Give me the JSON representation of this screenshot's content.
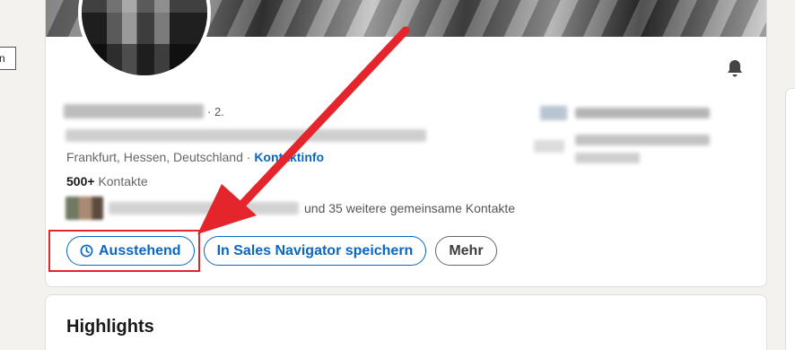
{
  "tooltip": {
    "text": "n"
  },
  "profile": {
    "degree": "· 2.",
    "location": "Frankfurt, Hessen, Deutschland ·",
    "contact_info": "Kontaktinfo",
    "connections_count": "500+",
    "connections_label": "Kontakte",
    "mutual_text": "und 35 weitere gemeinsame Kontakte"
  },
  "actions": {
    "pending": "Ausstehend",
    "sales_navigator": "In Sales Navigator speichern",
    "more": "Mehr"
  },
  "highlights": {
    "title": "Highlights"
  },
  "icons": {
    "pending": "clock-icon",
    "notifications": "bell-icon"
  },
  "colors": {
    "accent": "#0a66c2",
    "annotation": "#e4252c"
  }
}
